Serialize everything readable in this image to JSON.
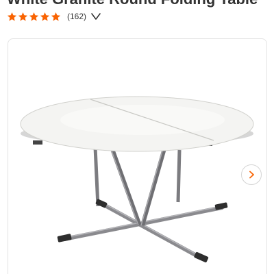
{
  "product": {
    "title": "White Granite Round Folding Table",
    "rating": 5,
    "max_rating": 5,
    "review_count": "(162)"
  },
  "gallery": {
    "next_icon": "chevron-right-icon"
  },
  "icons": {
    "star": "star-icon",
    "expand": "chevron-down-icon"
  },
  "colors": {
    "star": "#f96302",
    "title": "#333333",
    "card_border": "#e3e3e3",
    "next_arrow": "#f96302"
  }
}
